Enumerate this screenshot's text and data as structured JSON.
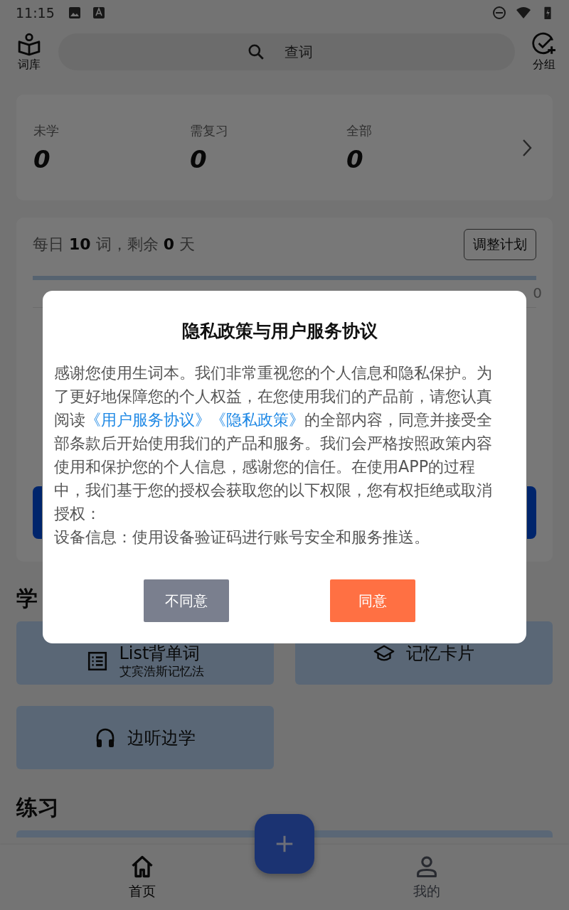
{
  "status_bar": {
    "time": "11:15"
  },
  "top_bar": {
    "left_button": "词库",
    "search": {
      "placeholder": "查词"
    },
    "right_button": "分组"
  },
  "stats": [
    {
      "label": "未学",
      "value": "0"
    },
    {
      "label": "需复习",
      "value": "0"
    },
    {
      "label": "全部",
      "value": "0"
    }
  ],
  "plan": {
    "summary": "每日 **10** 词，剩余 **0** 天",
    "button": "调整计划",
    "progress": {
      "level": 0
    },
    "progress_value": "0"
  },
  "study_section": {
    "title": "学",
    "tiles": [
      {
        "kind": "list",
        "title": "List背单词",
        "subtitle": "艾宾浩斯记忆法"
      },
      {
        "kind": "cards",
        "title": "记忆卡片"
      },
      {
        "kind": "listen",
        "title": "边听边学"
      }
    ]
  },
  "practice_section": {
    "title": "练习"
  },
  "bottom_nav": [
    {
      "kind": "home",
      "label": "首页",
      "selected": true
    },
    {
      "kind": "profile",
      "label": "我的",
      "selected": false
    }
  ],
  "dialog": {
    "title": "隐私政策与用户服务协议",
    "body": [
      {
        "kind": "text",
        "text": "感谢您使用生词本。我们非常重视您的个人信息和隐私保护。为了更好地保障您的个人权益，在您使用我们的产品前，请您认真阅读"
      },
      {
        "kind": "link",
        "text": "《用户服务协议》"
      },
      {
        "kind": "link",
        "text": "《隐私政策》"
      },
      {
        "kind": "text",
        "text": "的全部内容，同意并接受全部条款后开始使用我们的产品和服务。我们会严格按照政策内容使用和保护您的个人信息，感谢您的信任。在使用APP的过程中，我们基于您的授权会获取您的以下权限，您有权拒绝或取消授权："
      }
    ],
    "note": "设备信息：使用设备验证码进行账号安全和服务推送。",
    "buttons": [
      {
        "kind": "decline",
        "label": "不同意"
      },
      {
        "kind": "accept",
        "label": "同意"
      }
    ]
  }
}
